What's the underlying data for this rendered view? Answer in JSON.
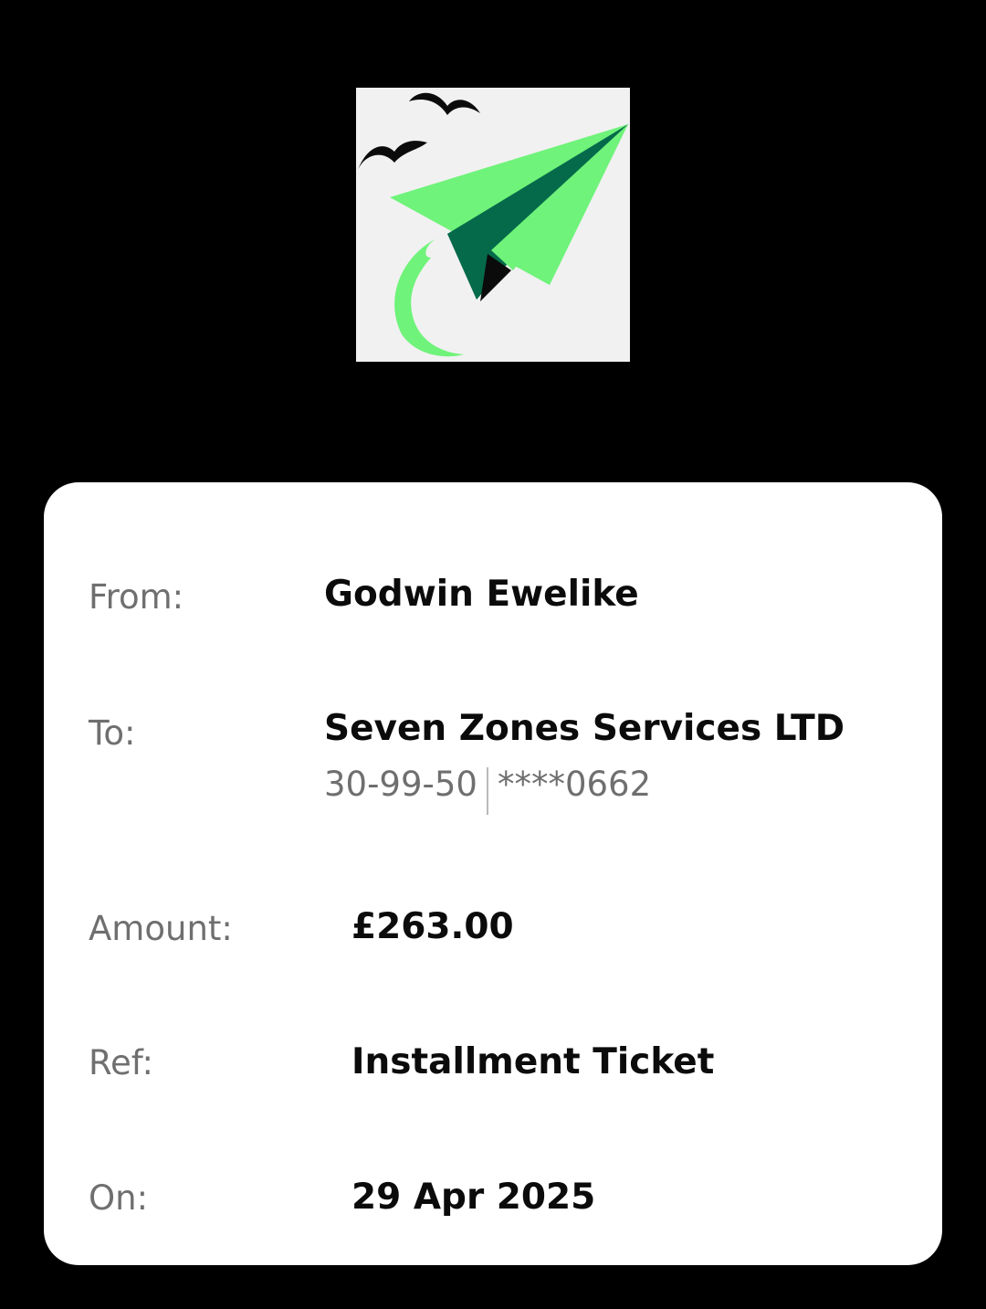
{
  "logo": {
    "icon": "paper-plane-with-birds-icon",
    "background": "#f1f1f1",
    "colors": {
      "plane_light": "#6ff37a",
      "plane_dark": "#046a4a",
      "birds": "#0b0b0b"
    }
  },
  "receipt": {
    "from": {
      "label": "From:",
      "value": "Godwin Ewelike"
    },
    "to": {
      "label": "To:",
      "value": "Seven Zones Services LTD",
      "sort_code": "30-99-50",
      "account": "****0662"
    },
    "amount": {
      "label": "Amount:",
      "value": "£263.00"
    },
    "ref": {
      "label": "Ref:",
      "value": "Installment Ticket"
    },
    "on": {
      "label": "On:",
      "value": "29 Apr 2025"
    }
  }
}
